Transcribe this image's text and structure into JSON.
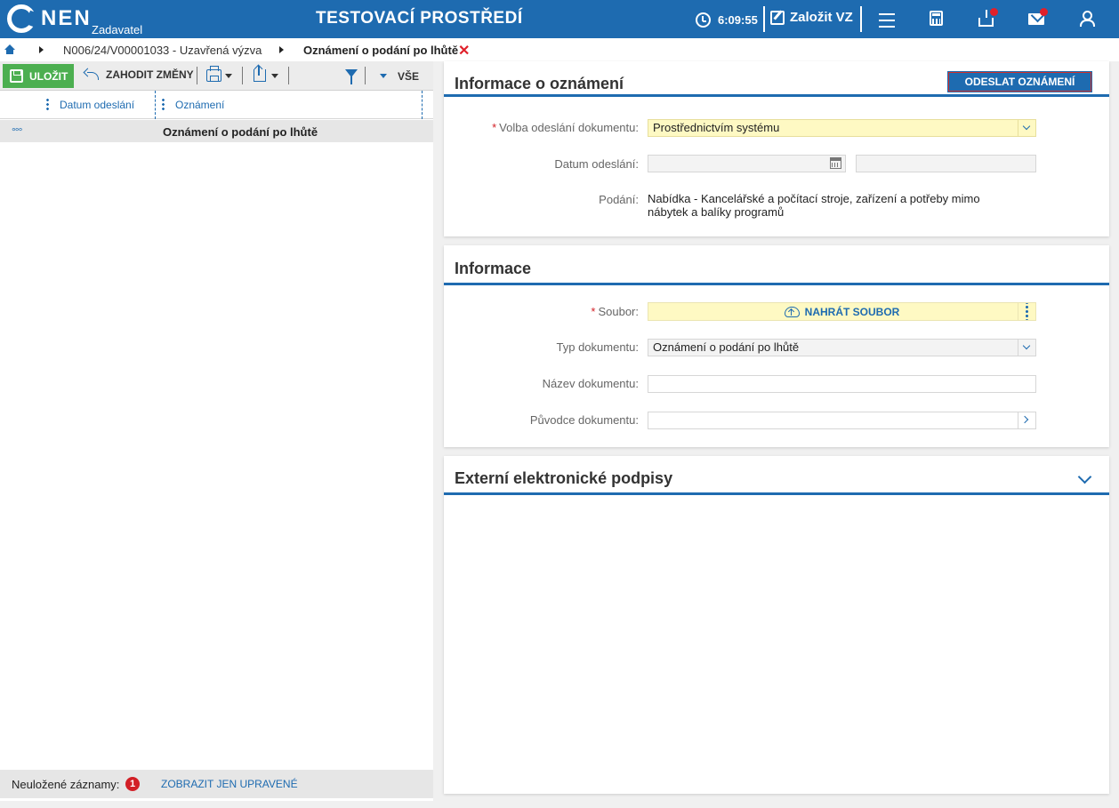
{
  "header": {
    "brand": "NEN",
    "brand_sub": "Zadavatel",
    "environment": "TESTOVACÍ PROSTŘEDÍ",
    "clock": "6:09:55",
    "create_label": "Založit VZ",
    "accent": "#1e6bb0"
  },
  "breadcrumb": {
    "items": [
      "N006/24/V00001033 - Uzavřená výzva",
      "Oznámení o podání po lhůtě"
    ]
  },
  "toolbar": {
    "save_label": "ULOŽIT",
    "discard_label": "ZAHODIT ZMĚNY",
    "view_label": "VŠE"
  },
  "grid": {
    "columns": [
      "Datum odeslání",
      "Oznámení"
    ],
    "rows": [
      {
        "menu": "°°°",
        "datum": "",
        "oznameni": "Oznámení o podání po lhůtě"
      }
    ],
    "footer_label": "Neuložené záznamy:",
    "footer_count": "1",
    "footer_link": "ZOBRAZIT JEN UPRAVENÉ"
  },
  "panel_notice": {
    "title": "Informace o oznámení",
    "send_button": "ODESLAT OZNÁMENÍ",
    "fields": {
      "volba_label": "Volba odeslání dokumentu:",
      "volba_value": "Prostřednictvím systému",
      "datum_label": "Datum odeslání:",
      "datum_value": "",
      "podani_label": "Podání:",
      "podani_value": "Nabídka - Kancelářské a počítací stroje, zařízení a potřeby mimo nábytek a balíky programů"
    }
  },
  "panel_info": {
    "title": "Informace",
    "fields": {
      "soubor_label": "Soubor:",
      "upload_label": "NAHRÁT SOUBOR",
      "typ_label": "Typ dokumentu:",
      "typ_value": "Oznámení o podání po lhůtě",
      "nazev_label": "Název dokumentu:",
      "nazev_value": "",
      "puvodce_label": "Původce dokumentu:",
      "puvodce_value": ""
    }
  },
  "panel_signatures": {
    "title": "Externí elektronické podpisy"
  }
}
